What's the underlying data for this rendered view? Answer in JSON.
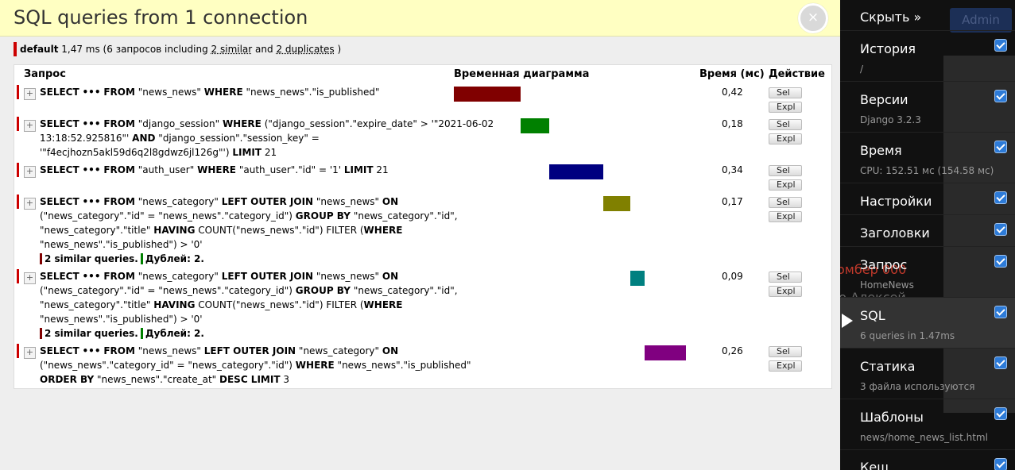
{
  "header": {
    "title": "SQL queries from 1 connection",
    "close_icon": "×"
  },
  "summary": {
    "alias": "default",
    "pre": " 1,47 ms (6 запросов including ",
    "similar": "2 similar",
    "mid": " and ",
    "duplicates": "2 duplicates",
    "post": " )"
  },
  "table": {
    "headers": {
      "query": "Запрос",
      "timeline": "Временная диаграмма",
      "time": "Время (мс)",
      "action": "Действие"
    },
    "sel_label": "Sel",
    "expl_label": "Expl",
    "toggle_label": "+",
    "similar_label": "2 similar queries.",
    "dup_label": "Дублей: 2.",
    "queries": [
      {
        "time": "0,42",
        "timeline": {
          "start": 0.0,
          "width": 0.2857,
          "color": "#800000"
        }
      },
      {
        "time": "0,18",
        "timeline": {
          "start": 0.2857,
          "width": 0.1224,
          "color": "#008000"
        }
      },
      {
        "time": "0,34",
        "timeline": {
          "start": 0.4082,
          "width": 0.2313,
          "color": "#000080"
        }
      },
      {
        "time": "0,17",
        "timeline": {
          "start": 0.6395,
          "width": 0.1156,
          "color": "#808000"
        }
      },
      {
        "time": "0,09",
        "timeline": {
          "start": 0.7551,
          "width": 0.0612,
          "color": "#008080"
        }
      },
      {
        "time": "0,26",
        "timeline": {
          "start": 0.8163,
          "width": 0.1769,
          "color": "#800080"
        }
      }
    ]
  },
  "sql": {
    "select": "SELECT",
    "dots": "•••",
    "from": "FROM",
    "where": "WHERE",
    "and": "AND",
    "limit": "LIMIT",
    "left_outer_join": "LEFT OUTER JOIN",
    "on": "ON",
    "group_by": "GROUP BY",
    "having": "HAVING",
    "order_by": "ORDER BY",
    "desc_limit": "DESC LIMIT",
    "news_news": "\"news_news\"",
    "is_published_cond": "\"news_news\".\"is_published\"",
    "django_session": "\"django_session\"",
    "q2_where_a": "(\"django_session\".\"expire_date\" > '\"2021-06-02",
    "q2_where_b": "13:18:52.925816\"'",
    "q2_where_c": "\"django_session\".\"session_key\" =",
    "q2_where_d": "'\"f4ecjhozn5akl59d6q2l8gdwz6jl126g\"')",
    "limit_21": "21",
    "auth_user": "\"auth_user\"",
    "q3_where": "\"auth_user\".\"id\" = '1'",
    "news_category": "\"news_category\"",
    "cat_join_a": "(\"news_category\".\"id\" = \"news_news\".\"category_id\")",
    "cat_group_a": "\"news_category\".\"id\",",
    "cat_group_b": "\"news_category\".\"title\"",
    "count_filter": "COUNT(\"news_news\".\"id\") FILTER (",
    "cat_filter_end": "\"news_news\".\"is_published\") > '0'",
    "q6_join_a": "(\"news_news\".\"category_id\" = \"news_category\".\"id\")",
    "q6_order": "\"news_news\".\"create_at\"",
    "limit_3": "3"
  },
  "sidebar": {
    "hide_label": "Скрыть »",
    "admin_label": "Admin",
    "items": [
      {
        "label": "История",
        "sub": "/"
      },
      {
        "label": "Версии",
        "sub": "Django 3.2.3"
      },
      {
        "label": "Время",
        "sub": "CPU: 152.51 мс (154.58 мс)"
      },
      {
        "label": "Настройки",
        "sub": ""
      },
      {
        "label": "Заголовки",
        "sub": ""
      },
      {
        "label": "Запрос",
        "sub": "HomeNews"
      },
      {
        "label": "SQL",
        "sub": "6 queries in 1.47ms"
      },
      {
        "label": "Статика",
        "sub": "3 файла используются"
      },
      {
        "label": "Шаблоны",
        "sub": "news/home_news_list.html"
      },
      {
        "label": "Кеш",
        "sub": ""
      }
    ],
    "bg_text_1": "омбер 000",
    "bg_text_2": "ого Алексей"
  },
  "colors": {
    "header_bg": "#ffffc2",
    "sidebar_bg": "#111111",
    "row_marker": "#cc0000",
    "checkbox": "#2d7bd8"
  }
}
